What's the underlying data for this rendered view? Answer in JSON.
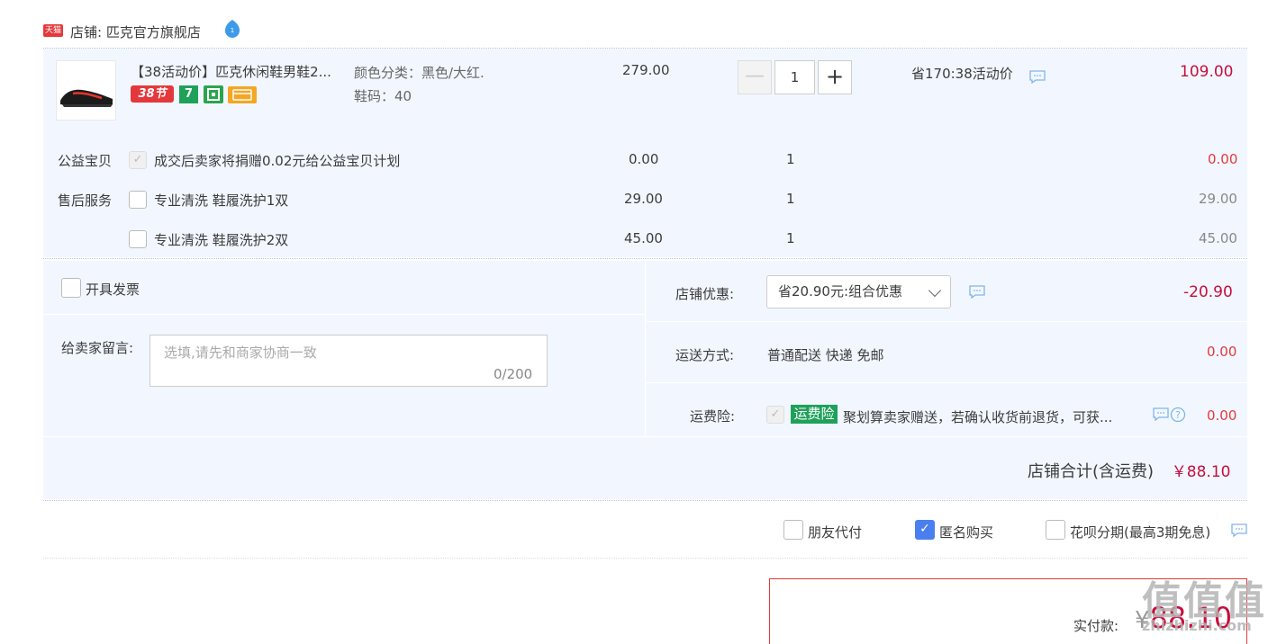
{
  "store": {
    "badge": "天猫",
    "label": "店铺: 匹克官方旗舰店"
  },
  "item": {
    "title": "【38活动价】匹克休闲鞋男鞋2...",
    "tag_38": "38节",
    "tag_7": "7",
    "sku_color": "颜色分类：黑色/大红.",
    "sku_size": "鞋码：40",
    "unit_price": "279.00",
    "quantity": "1",
    "qty_minus": "—",
    "qty_plus": "+",
    "promo": "省170:38活动价",
    "total": "109.00"
  },
  "services": {
    "charity_label": "公益宝贝",
    "charity_text": "成交后卖家将捐赠0.02元给公益宝贝计划",
    "charity_price": "0.00",
    "charity_qty": "1",
    "charity_total": "0.00",
    "aftersale_label": "售后服务",
    "option1_text": "专业清洗 鞋履洗护1双",
    "option1_price": "29.00",
    "option1_qty": "1",
    "option1_total": "29.00",
    "option2_text": "专业清洗 鞋履洗护2双",
    "option2_price": "45.00",
    "option2_qty": "1",
    "option2_total": "45.00"
  },
  "order": {
    "invoice_label": "开具发票",
    "note_label": "给卖家留言:",
    "note_placeholder": "选填,请先和商家协商一致",
    "note_count": "0/200",
    "discount_label": "店铺优惠:",
    "discount_option": "省20.90元:组合优惠",
    "discount_value": "-20.90",
    "shipping_label": "运送方式:",
    "shipping_method": "普通配送 快递 免邮",
    "shipping_value": "0.00",
    "insurance_label": "运费险:",
    "insurance_tag": "运费险",
    "insurance_text": "聚划算卖家赠送，若确认收货前退货，可获...",
    "insurance_value": "0.00",
    "store_total_label": "店铺合计(含运费)",
    "store_total_value": "￥88.10"
  },
  "payment_options": {
    "friend_pay": "朋友代付",
    "anonymous": "匿名购买",
    "huabei": "花呗分期(最高3期免息)"
  },
  "final": {
    "label": "实付款:",
    "currency": "¥",
    "amount": "88.10"
  },
  "watermark": {
    "main": "值值值",
    "sub": "zhizhizhi.com"
  },
  "colors": {
    "accent_red": "#c80e3c",
    "panel_bg": "#f2f7ff",
    "check_blue": "#4a7ff0",
    "tag_green": "#1fa15a"
  }
}
